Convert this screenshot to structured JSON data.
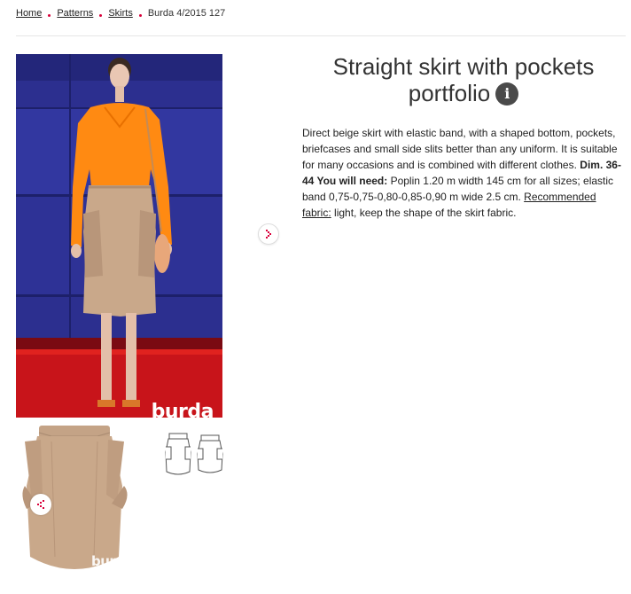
{
  "breadcrumb": {
    "home": "Home",
    "patterns": "Patterns",
    "skirts": "Skirts",
    "current": "Burda 4/2015 127"
  },
  "product": {
    "title_line1": "Straight skirt with pockets",
    "title_line2": "portfolio",
    "info_glyph": "i",
    "description": {
      "text1": "Direct beige skirt with elastic band, with a shaped bottom, pockets, briefcases and small side slits better than any uniform. It is suitable for many occasions and is combined with different clothes. ",
      "dim_label": "Dim. 36-44 You will need:",
      "text2": " Poplin 1.20 m width 145 cm for all sizes; elastic band 0,75-0,75-0,80-0,85-0,90 m wide 2.5 cm. ",
      "fabric_label": "Recommended fabric:",
      "text3": " light, keep the shape of the skirt fabric."
    }
  },
  "images": {
    "main_watermark": "burda",
    "thumb_watermark": "burda"
  },
  "icons": {
    "next": "chevron-right-icon",
    "share": "share-icon",
    "info": "info-icon"
  },
  "colors": {
    "accent": "#d9003a",
    "wall_blue": "#2c2f8f",
    "carpet_red": "#c8141a",
    "blouse_orange": "#ff8a12",
    "skirt_beige": "#c9a88a"
  }
}
